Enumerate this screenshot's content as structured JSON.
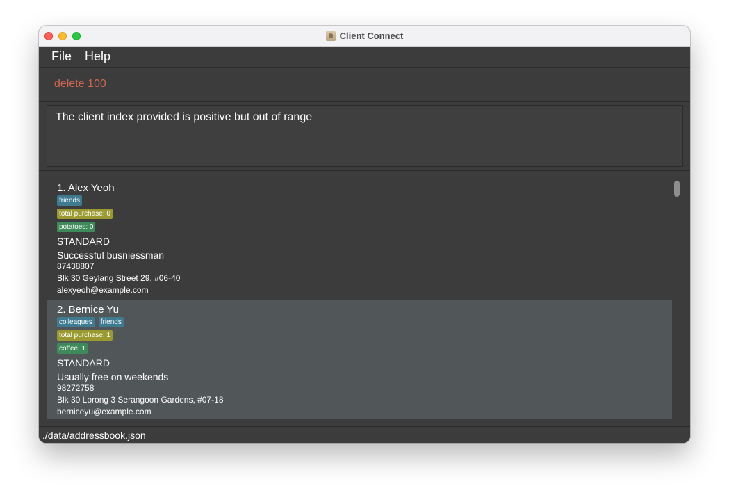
{
  "window": {
    "title": "Client Connect"
  },
  "menu": {
    "items": [
      "File",
      "Help"
    ]
  },
  "command": {
    "value": "delete 100"
  },
  "result": {
    "message": "The client index provided is positive but out of range"
  },
  "clients": [
    {
      "name": "1. Alex Yeoh",
      "tags": [
        "friends"
      ],
      "purchase_tag": "total purchase: 0",
      "product_tags": [
        "potatoes: 0"
      ],
      "tier": "STANDARD",
      "remark": "Successful busniessman",
      "phone": "87438807",
      "address": "Blk 30 Geylang Street 29, #06-40",
      "email": "alexyeoh@example.com"
    },
    {
      "name": "2. Bernice Yu",
      "tags": [
        "colleagues",
        "friends"
      ],
      "purchase_tag": "total purchase: 1",
      "product_tags": [
        "coffee: 1"
      ],
      "tier": "STANDARD",
      "remark": "Usually free on weekends",
      "phone": "98272758",
      "address": "Blk 30 Lorong 3 Serangoon Gardens, #07-18",
      "email": "berniceyu@example.com"
    }
  ],
  "status": {
    "path": "./data/addressbook.json"
  },
  "colors": {
    "command_text": "#d06651",
    "tag_blue": "#3e7b91",
    "tag_olive": "#9a9a31",
    "tag_green": "#3e8a5a",
    "selected_card": "#515658",
    "background": "#3c3c3c"
  }
}
